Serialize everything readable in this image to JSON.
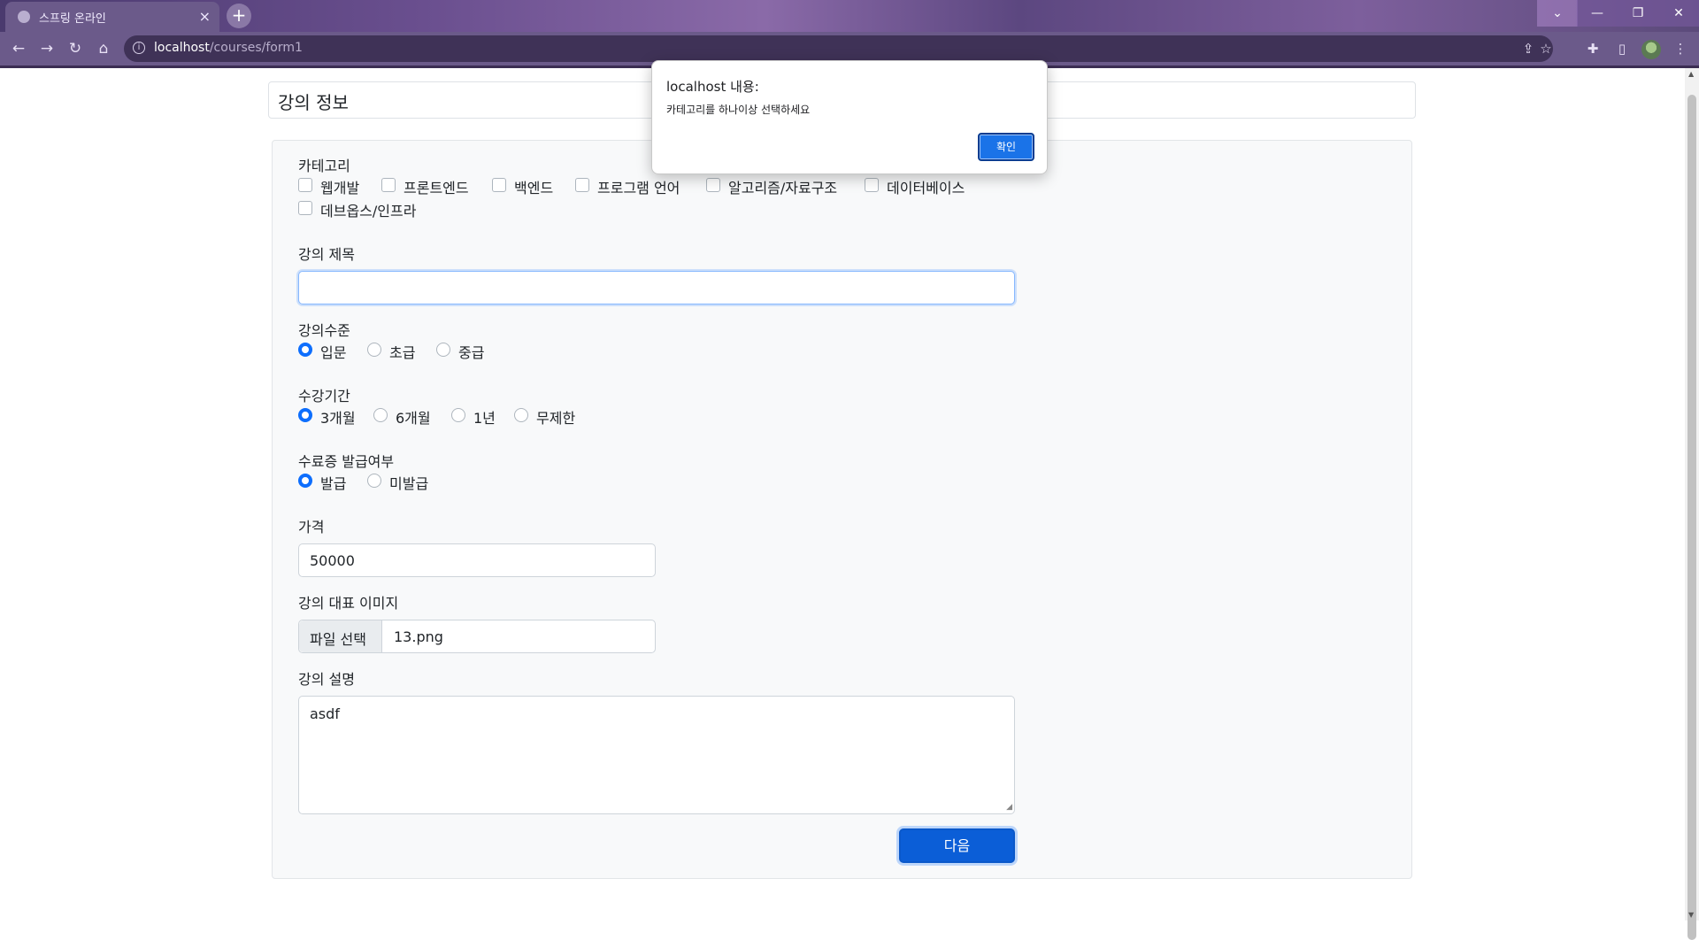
{
  "browser": {
    "tab_title": "스프링 온라인",
    "tab_close": "×",
    "new_tab": "+",
    "url_host": "localhost",
    "url_path": "/courses/form1"
  },
  "page": {
    "header_title": "강의 정보",
    "category": {
      "label": "카테고리",
      "options": [
        "웹개발",
        "프론트엔드",
        "백엔드",
        "프로그램 언어",
        "알고리즘/자료구조",
        "데이터베이스",
        "데브옵스/인프라"
      ]
    },
    "title_field": {
      "label": "강의 제목",
      "value": ""
    },
    "level": {
      "label": "강의수준",
      "options": [
        "입문",
        "초급",
        "중급"
      ],
      "selected": "입문"
    },
    "period": {
      "label": "수강기간",
      "options": [
        "3개월",
        "6개월",
        "1년",
        "무제한"
      ],
      "selected": "3개월"
    },
    "certificate": {
      "label": "수료증 발급여부",
      "options": [
        "발급",
        "미발급"
      ],
      "selected": "발급"
    },
    "price": {
      "label": "가격",
      "value": "50000"
    },
    "image": {
      "label": "강의 대표 이미지",
      "button": "파일 선택",
      "file_name": "13.png"
    },
    "description": {
      "label": "강의 설명",
      "value": "asdf"
    },
    "next_button": "다음"
  },
  "dialog": {
    "title": "localhost 내용:",
    "message": "카테고리를 하나이상 선택하세요",
    "ok_button": "확인"
  },
  "colors": {
    "accent": "#0d6efd",
    "browser_theme": "#6b5a8a"
  },
  "icons": [
    "globe-icon",
    "back-icon",
    "forward-icon",
    "reload-icon",
    "home-icon",
    "info-icon",
    "share-icon",
    "star-icon",
    "extensions-icon",
    "sidepanel-icon",
    "menu-icon"
  ]
}
